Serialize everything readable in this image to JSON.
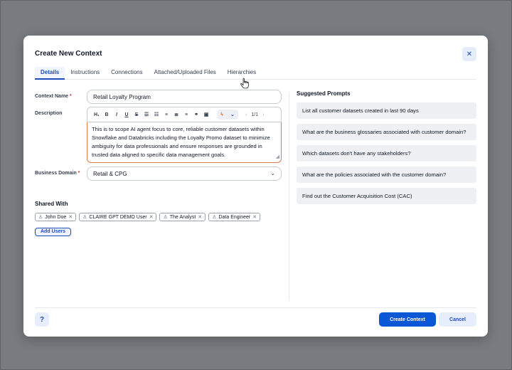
{
  "modal": {
    "title": "Create New Context",
    "close_icon": "close-icon",
    "tabs": [
      {
        "label": "Details",
        "active": true
      },
      {
        "label": "Instructions"
      },
      {
        "label": "Connections"
      },
      {
        "label": "Attached/Uploaded Files"
      },
      {
        "label": "Hierarchies"
      }
    ]
  },
  "form": {
    "context_name": {
      "label": "Context Name",
      "required": "*",
      "value": "Retail Loyalty Program"
    },
    "description": {
      "label": "Description",
      "toolbar": {
        "heading": "H₁",
        "bold": "B",
        "italic": "I",
        "underline": "U",
        "strike": "S",
        "pager": "1/1"
      },
      "value": "This is to scope AI agent focus to core, reliable customer datasets within Snowflake and Databricks including the Loyalty Promo dataset to minimize ambiguity for data professionals and ensure responses are grounded in trusted data aligned to specific data management goals."
    },
    "business_domain": {
      "label": "Business Domain",
      "required": "*",
      "value": "Retail & CPG"
    }
  },
  "shared_with": {
    "title": "Shared With",
    "users": [
      "John Doe",
      "CLAIRE GPT DEMO User",
      "The Analyst",
      "Data Engineer"
    ],
    "add_button": "Add Users"
  },
  "suggested_prompts": {
    "title": "Suggested Prompts",
    "items": [
      "List all customer datasets created in last 90 days",
      "What are the business glossaries associated with customer domain?",
      "Which datasets don't have any stakeholders?",
      "What are the policies associated with the customer domain?",
      "Find out the Customer Acquisition Cost (CAC)"
    ]
  },
  "footer": {
    "help": "?",
    "primary_button": "Create Context",
    "cancel_button": "Cancel"
  },
  "colors": {
    "accent": "#0b58d6",
    "backdrop": "#787b80",
    "editor_focus_border": "#e07a46",
    "required": "#d32f2f"
  }
}
